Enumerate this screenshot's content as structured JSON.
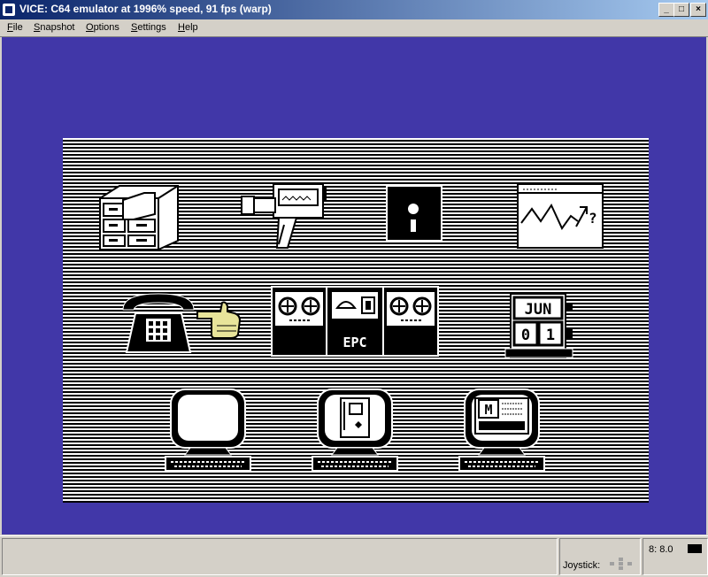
{
  "window": {
    "title": "VICE: C64 emulator at 1996% speed, 91 fps (warp)"
  },
  "menu": {
    "items": [
      {
        "label": "File",
        "accel": "F",
        "rest": "ile"
      },
      {
        "label": "Snapshot",
        "accel": "S",
        "rest": "napshot"
      },
      {
        "label": "Options",
        "accel": "O",
        "rest": "ptions"
      },
      {
        "label": "Settings",
        "accel": "S",
        "rest": "ettings"
      },
      {
        "label": "Help",
        "accel": "H",
        "rest": "elp"
      }
    ]
  },
  "c64_screen": {
    "colors": {
      "border": "#4137a8",
      "stripe_light": "#ffffff",
      "stripe_dark": "#000000",
      "hand": "#e8e49a"
    },
    "icons": [
      {
        "id": "filing-cabinet-icon"
      },
      {
        "id": "video-camera-icon"
      },
      {
        "id": "floppy-disk-icon"
      },
      {
        "id": "graph-chart-icon",
        "text": "?"
      },
      {
        "id": "telephone-icon"
      },
      {
        "id": "pointing-hand-icon"
      },
      {
        "id": "tape-machine-icon",
        "text": "EPC"
      },
      {
        "id": "calendar-icon",
        "month": "JUN",
        "day_tens": "0",
        "day_ones": "1"
      },
      {
        "id": "computer-blank-icon"
      },
      {
        "id": "computer-document-icon"
      },
      {
        "id": "computer-window-icon",
        "text": "M"
      }
    ]
  },
  "statusbar": {
    "joystick_label": "Joystick:",
    "drive_label": "8: 8.0"
  }
}
